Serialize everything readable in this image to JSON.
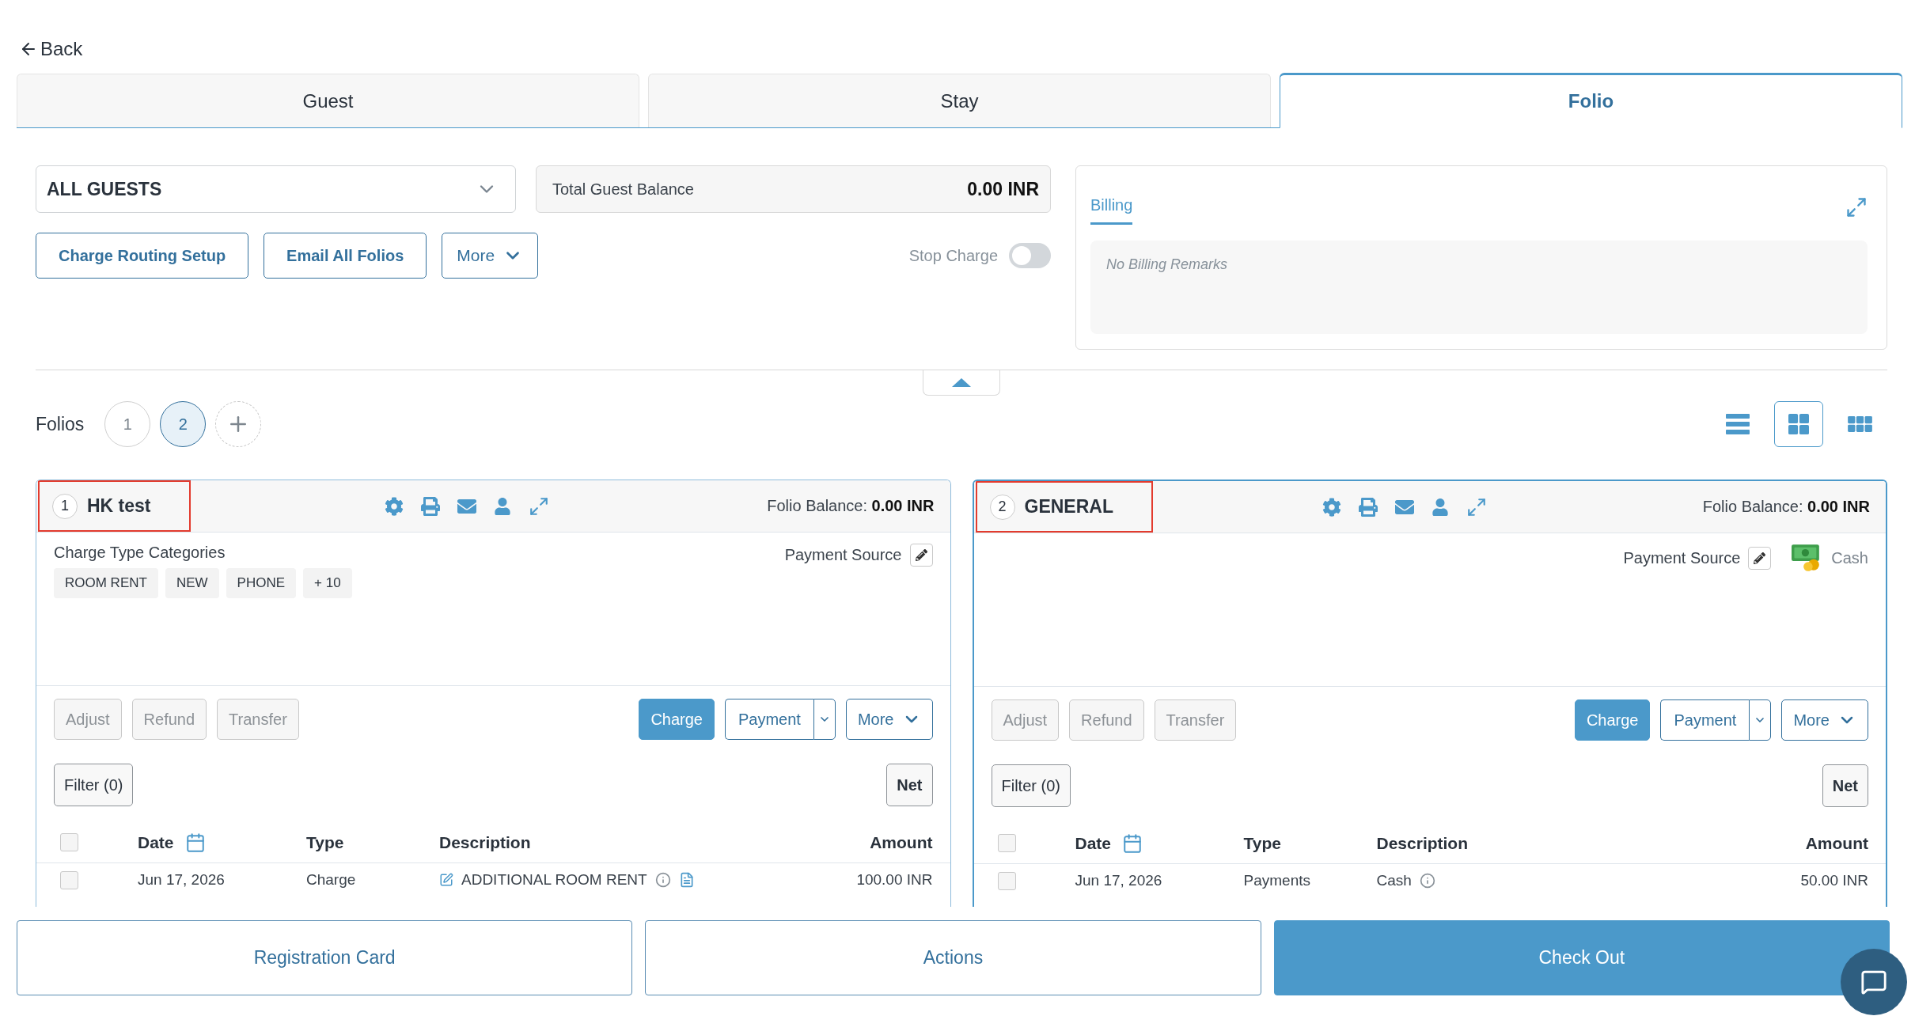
{
  "back": {
    "label": "Back"
  },
  "tabs": [
    {
      "label": "Guest",
      "selected": false
    },
    {
      "label": "Stay",
      "selected": false
    },
    {
      "label": "Folio",
      "selected": true
    }
  ],
  "guest_select": {
    "value": "ALL GUESTS"
  },
  "total_balance": {
    "label": "Total Guest Balance",
    "value": "0.00 INR"
  },
  "actions": [
    {
      "label": "Charge Routing Setup",
      "kind": "button"
    },
    {
      "label": "Email All Folios",
      "kind": "button"
    },
    {
      "label": "More",
      "kind": "menu"
    }
  ],
  "stop_charge": {
    "label": "Stop Charge",
    "on": false
  },
  "billing": {
    "tabs": [
      {
        "label": "Billing",
        "selected": true
      }
    ],
    "remarks": "No Billing Remarks"
  },
  "folios_bar": {
    "label": "Folios",
    "folios": [
      {
        "label": "1",
        "selected": false
      },
      {
        "label": "2",
        "selected": true
      }
    ],
    "view_modes": [
      {
        "kind": "list",
        "selected": false
      },
      {
        "kind": "grid",
        "selected": true
      },
      {
        "kind": "dense-grid",
        "selected": false
      }
    ]
  },
  "folio_cards": [
    {
      "number": "1",
      "name": "HK test",
      "selected": false,
      "highlighted": true,
      "balance": "Folio Balance: **0.00 INR**",
      "categories": {
        "label": "Charge Type Categories",
        "tags": [
          "ROOM RENT",
          "NEW",
          "PHONE",
          "+ 10"
        ]
      },
      "payment_source": {
        "label": "Payment Source"
      },
      "buttons": [
        {
          "label": "Adjust",
          "kind": "plain",
          "disabled": true
        },
        {
          "label": "Refund",
          "kind": "plain",
          "disabled": true
        },
        {
          "label": "Transfer",
          "kind": "plain",
          "disabled": true
        },
        {
          "label": "Charge",
          "kind": "primary",
          "disabled": false
        },
        {
          "label": "Payment",
          "kind": "split",
          "disabled": false
        },
        {
          "label": "More",
          "kind": "menu",
          "disabled": false
        }
      ],
      "filter": "Filter (0)",
      "net": "Net",
      "all_checked": false,
      "columns": [
        {
          "label": "Date",
          "kind": "date"
        },
        {
          "label": "Type",
          "kind": "text"
        },
        {
          "label": "Description",
          "kind": "text"
        },
        {
          "label": "Amount",
          "kind": "amount"
        }
      ],
      "rows": [
        {
          "kind": "charge",
          "checked": false,
          "date": "Jun 17, 2026",
          "type": "Charge",
          "description": "ADDITIONAL ROOM RENT",
          "amount": "100.00 INR"
        }
      ]
    },
    {
      "number": "2",
      "name": "GENERAL",
      "selected": true,
      "highlighted": true,
      "balance": "Folio Balance: **0.00 INR**",
      "payment_source": {
        "label": "Payment Source",
        "value": "Cash"
      },
      "buttons": [
        {
          "label": "Adjust",
          "kind": "plain",
          "disabled": true
        },
        {
          "label": "Refund",
          "kind": "plain",
          "disabled": true
        },
        {
          "label": "Transfer",
          "kind": "plain",
          "disabled": true
        },
        {
          "label": "Charge",
          "kind": "primary",
          "disabled": false
        },
        {
          "label": "Payment",
          "kind": "split",
          "disabled": false
        },
        {
          "label": "More",
          "kind": "menu",
          "disabled": false
        }
      ],
      "filter": "Filter (0)",
      "net": "Net",
      "all_checked": false,
      "columns": [
        {
          "label": "Date",
          "kind": "date"
        },
        {
          "label": "Type",
          "kind": "text"
        },
        {
          "label": "Description",
          "kind": "text"
        },
        {
          "label": "Amount",
          "kind": "amount"
        }
      ],
      "rows": [
        {
          "kind": "payment",
          "checked": false,
          "date": "Jun 17, 2026",
          "type": "Payments",
          "description": "Cash",
          "amount": "50.00 INR"
        }
      ]
    }
  ],
  "bottom_buttons": [
    {
      "label": "Registration Card",
      "kind": "outline"
    },
    {
      "label": "Actions",
      "kind": "outline"
    },
    {
      "label": "Check Out",
      "kind": "primary"
    }
  ]
}
